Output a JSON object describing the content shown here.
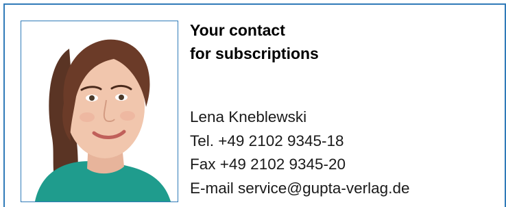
{
  "contact_card": {
    "heading": {
      "line1": "Your contact",
      "line2": "for subscriptions"
    },
    "name": "Lena Kneblewski",
    "tel": "Tel. +49 2102 9345-18",
    "fax": "Fax +49 2102 9345-20",
    "email": "E-mail service@gupta-verlag.de"
  },
  "colors": {
    "frame": "#2f7ab8",
    "text": "#1a1a1a",
    "heading": "#000000",
    "background": "#ffffff"
  }
}
